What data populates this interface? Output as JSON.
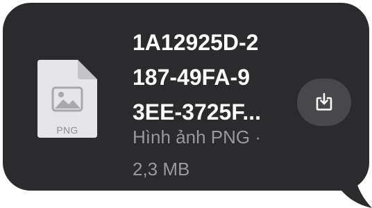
{
  "file": {
    "name_lines": [
      "1A12925D-2",
      "187-49FA-9",
      "3EE-3725F..."
    ],
    "extension_label": "PNG",
    "type_line": "Hình ảnh PNG ·",
    "size_line": "2,3 MB",
    "icon": "image-file-icon"
  },
  "actions": {
    "download_icon": "download-icon"
  },
  "colors": {
    "bubble_background": "#2b2b2d",
    "file_icon_paper": "#e6e6e8",
    "button_background": "#48484b",
    "title_text": "#ffffff",
    "meta_text": "#9a9a9e"
  }
}
